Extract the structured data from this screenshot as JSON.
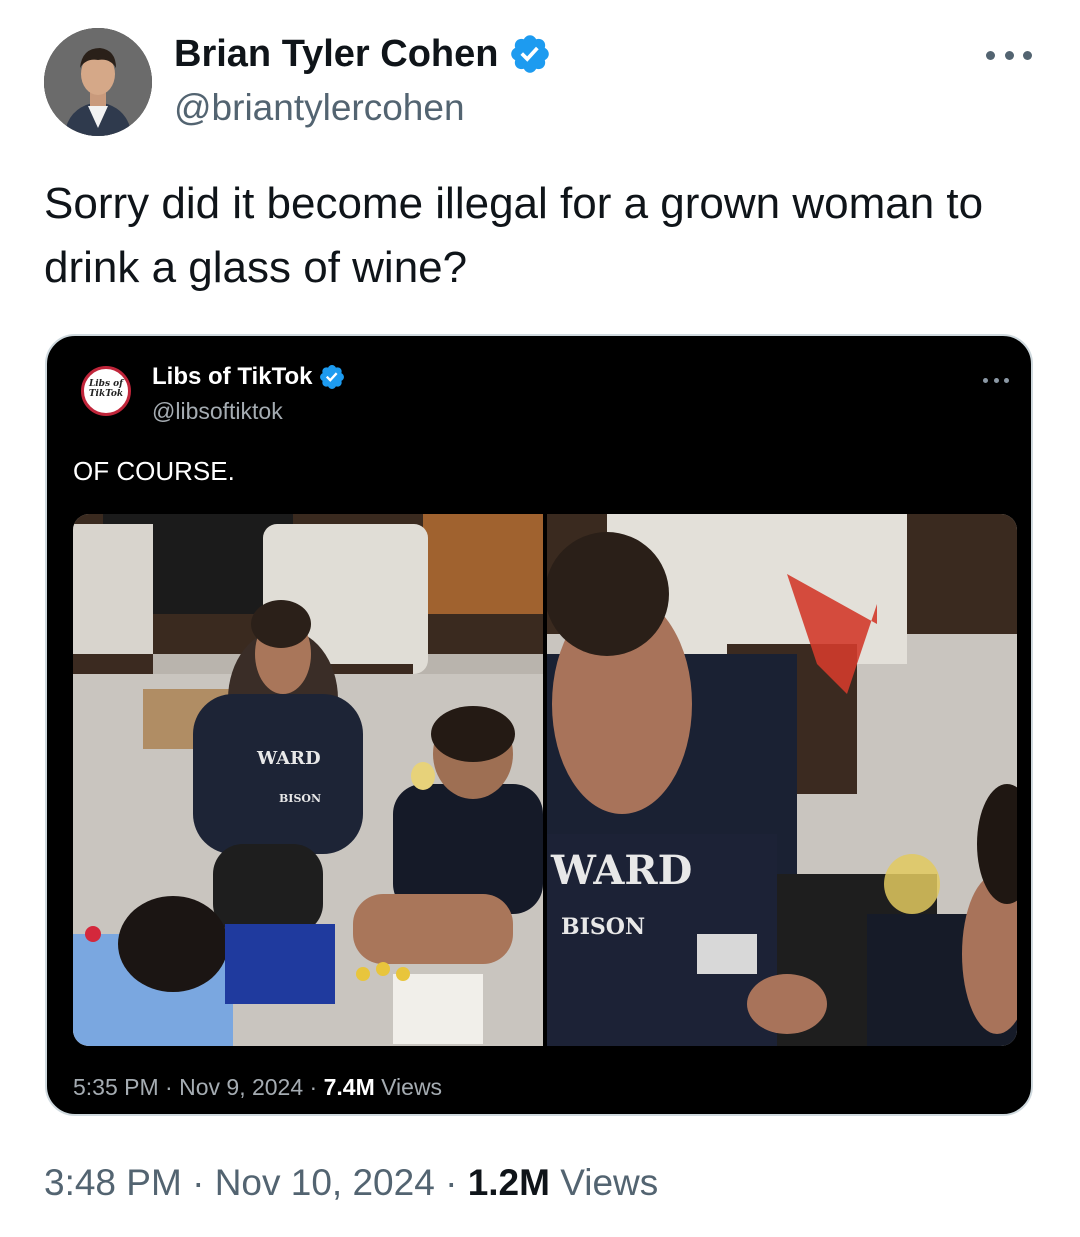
{
  "tweet": {
    "display_name": "Brian Tyler Cohen",
    "handle": "@briantylercohen",
    "text": "Sorry did it become illegal for a grown woman to drink a glass of wine?",
    "time": "3:48 PM",
    "separator": "·",
    "date": "Nov 10, 2024",
    "views_count": "1.2M",
    "views_label": "Views",
    "verified_icon": "verified-badge-icon",
    "more_icon": "more-options-icon",
    "accent_color": "#1d9bf0"
  },
  "quoted": {
    "display_name": "Libs of TikTok",
    "handle": "@libsoftiktok",
    "avatar_text": "Libs of TikTok",
    "text": "OF COURSE.",
    "time": "5:35 PM",
    "separator": "·",
    "date": "Nov 9, 2024",
    "views_count": "7.4M",
    "views_label": "Views",
    "background_color": "#000000",
    "images": [
      {
        "description_icon": "photo-image",
        "shirt_text": "WARD",
        "shirt_subtext": "BISON"
      },
      {
        "description_icon": "photo-image-zoomed",
        "shirt_text": "WARD",
        "shirt_subtext": "BISON"
      }
    ]
  }
}
